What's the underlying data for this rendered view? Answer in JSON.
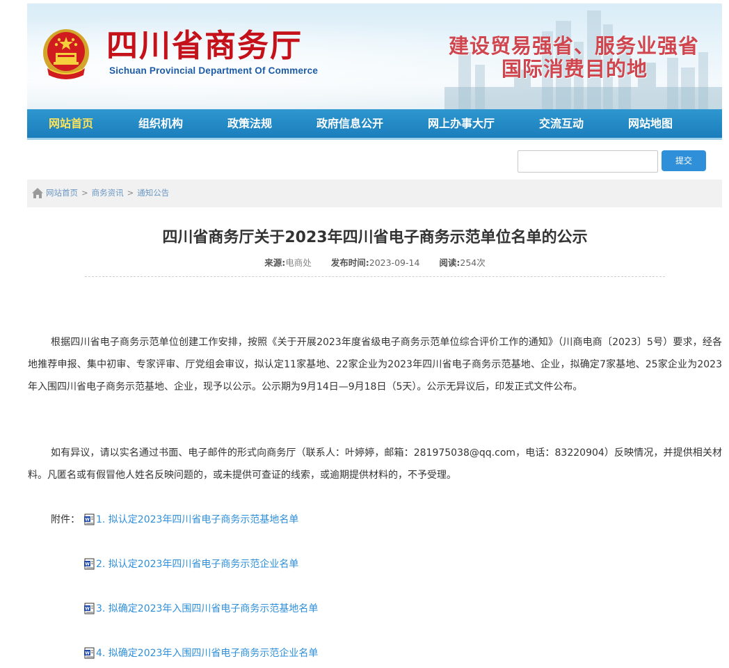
{
  "header": {
    "title_cn": "四川省商务厅",
    "title_en": "Sichuan Provincial Department Of Commerce",
    "slogan_line1": "建设贸易强省、服务业强省",
    "slogan_line2": "国际消费目的地",
    "emblem_icon": "national-emblem-icon",
    "colors": {
      "title": "#c4111a",
      "subtitle": "#1a5aa6",
      "slogan": "#d0464f"
    }
  },
  "nav": {
    "items": [
      {
        "label": "网站首页",
        "active": true
      },
      {
        "label": "组织机构"
      },
      {
        "label": "政策法规"
      },
      {
        "label": "政府信息公开"
      },
      {
        "label": "网上办事大厅"
      },
      {
        "label": "交流互动"
      },
      {
        "label": "网站地图"
      }
    ],
    "colors": {
      "bar": "#1f88c4",
      "active_text": "#ffe35a"
    }
  },
  "search": {
    "value": "",
    "button_label": "提交"
  },
  "breadcrumb": {
    "icon": "home-icon",
    "items": [
      "网站首页",
      "商务资讯",
      "通知公告"
    ],
    "separator": ">"
  },
  "article": {
    "title": "四川省商务厅关于2023年四川省电子商务示范单位名单的公示",
    "meta": {
      "source_label": "来源:",
      "source": "电商处",
      "date_label": "发布时间:",
      "date": "2023-09-14",
      "reads_label": "阅读:",
      "reads": "254次"
    },
    "paragraphs": [
      "根据四川省电子商务示范单位创建工作安排，按照《关于开展2023年度省级电子商务示范单位综合评价工作的通知》（川商电商〔2023〕5号）要求，经各地推荐申报、集中初审、专家评审、厅党组会审议，拟认定11家基地、22家企业为2023年四川省电子商务示范基地、企业，拟确定7家基地、25家企业为2023年入围四川省电子商务示范基地、企业，现予以公示。公示期为9月14日—9月18日（5天）。公示无异议后，印发正式文件公布。",
      "如有异议，请以实名通过书面、电子邮件的形式向商务厅（联系人：叶婷婷，邮箱：281975038@qq.com，电话：83220904）反映情况，并提供相关材料。凡匿名或有假冒他人姓名反映问题的，或未提供可查证的线索，或逾期提供材料的，不予受理。"
    ],
    "attachments_label": "附件：",
    "attachments": [
      {
        "label": "1. 拟认定2023年四川省电子商务示范基地名单",
        "icon": "word-doc-icon"
      },
      {
        "label": "2. 拟认定2023年四川省电子商务示范企业名单",
        "icon": "word-doc-icon"
      },
      {
        "label": "3. 拟确定2023年入围四川省电子商务示范基地名单",
        "icon": "word-doc-icon"
      },
      {
        "label": "4. 拟确定2023年入围四川省电子商务示范企业名单",
        "icon": "word-doc-icon"
      }
    ],
    "colors": {
      "link": "#2f8fd8"
    }
  }
}
